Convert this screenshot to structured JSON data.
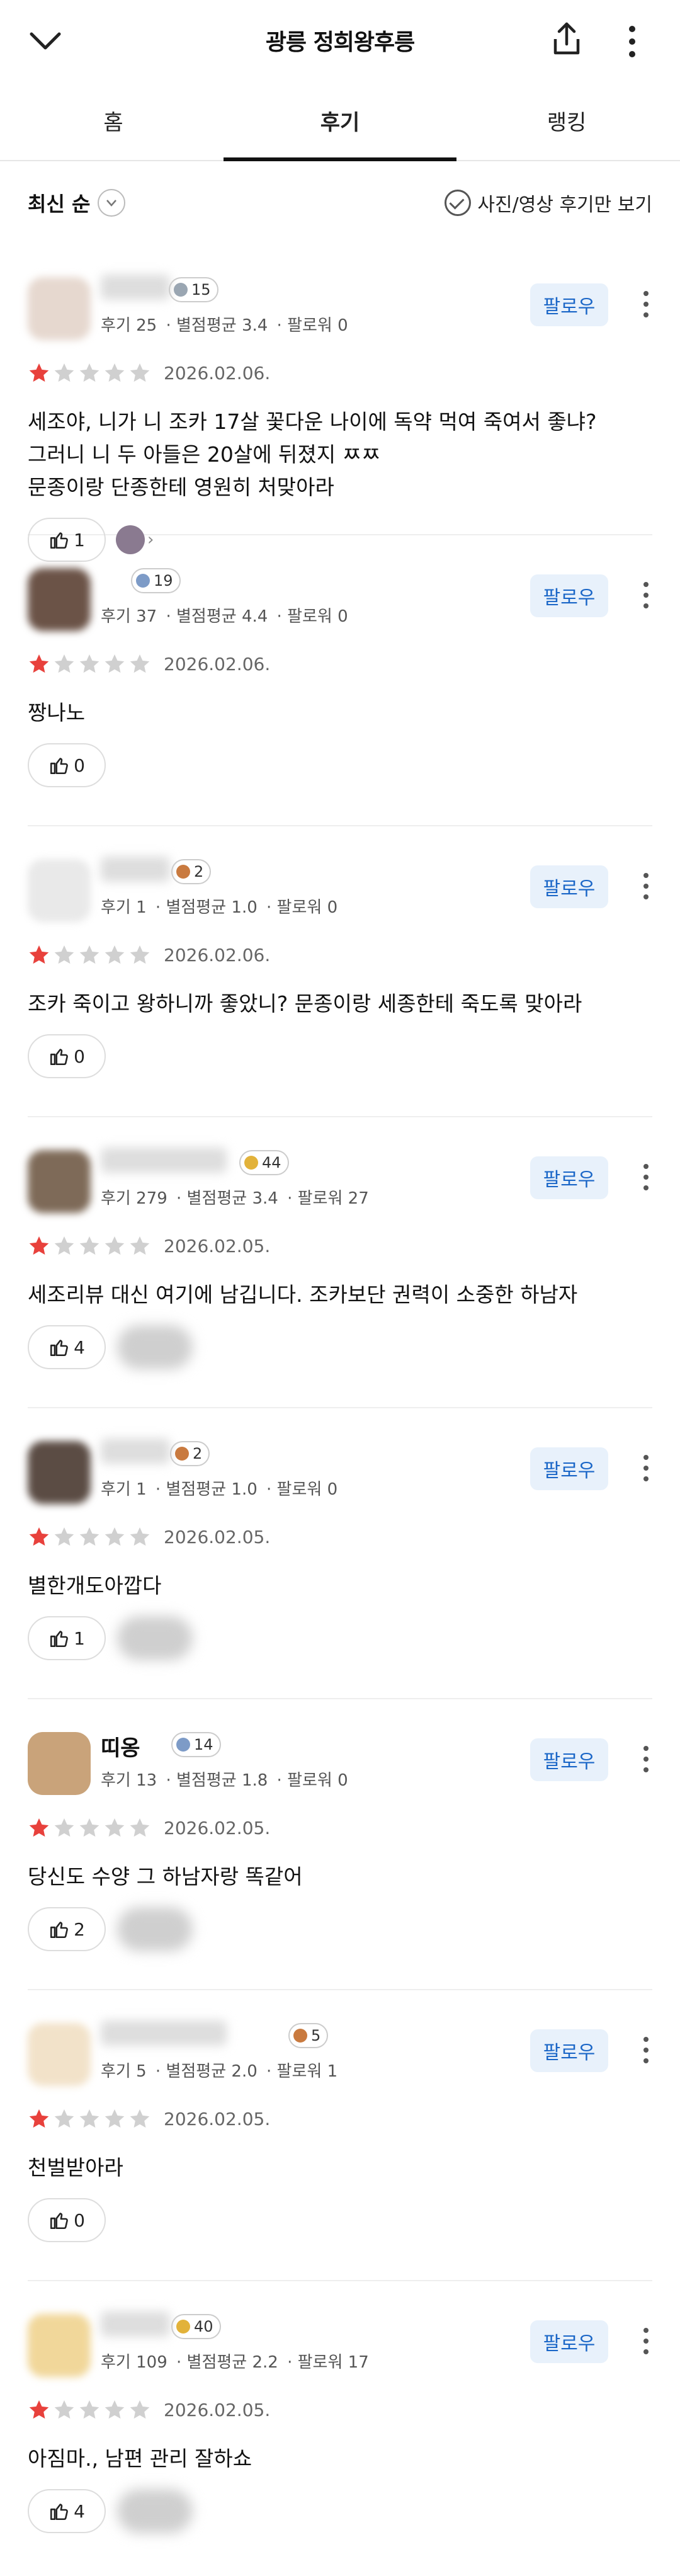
{
  "header": {
    "title": "광릉 정희왕후릉"
  },
  "tabs": [
    {
      "label": "홈"
    },
    {
      "label": "후기"
    },
    {
      "label": "랭킹"
    }
  ],
  "filter": {
    "sort_label": "최신 순",
    "photo_only_label": "사진/영상 후기만 보기"
  },
  "follow_label": "팔로우",
  "reviews": [
    {
      "name": "",
      "badge": "15",
      "reviews": "후기 25",
      "avg": "별점평균 3.4",
      "followers": "팔로워 0",
      "date": "2026.02.06.",
      "rating": 1,
      "lines": [
        "세조야, 니가 니 조카 17살 꽃다운 나이에 독약 먹여 죽여서 좋냐?",
        "그러니 니 두 아들은 20살에 뒤졌지 ㅉㅉ",
        "문종이랑 단종한테 영원히 처맞아라"
      ],
      "likes": "1"
    },
    {
      "name": "",
      "badge": "19",
      "reviews": "후기 37",
      "avg": "별점평균 4.4",
      "followers": "팔로워 0",
      "date": "2026.02.06.",
      "rating": 1,
      "lines": [
        "짱나노"
      ],
      "likes": "0"
    },
    {
      "name": "",
      "badge": "2",
      "reviews": "후기 1",
      "avg": "별점평균 1.0",
      "followers": "팔로워 0",
      "date": "2026.02.06.",
      "rating": 1,
      "lines": [
        "조카 죽이고 왕하니까 좋았니? 문종이랑 세종한테 죽도록 맞아라"
      ],
      "likes": "0"
    },
    {
      "name": "",
      "badge": "44",
      "reviews": "후기 279",
      "avg": "별점평균 3.4",
      "followers": "팔로워 27",
      "date": "2026.02.05.",
      "rating": 1,
      "lines": [
        "세조리뷰 대신 여기에 남깁니다. 조카보단 권력이 소중한 하남자"
      ],
      "likes": "4"
    },
    {
      "name": "",
      "badge": "2",
      "reviews": "후기 1",
      "avg": "별점평균 1.0",
      "followers": "팔로워 0",
      "date": "2026.02.05.",
      "rating": 1,
      "lines": [
        "별한개도아깝다"
      ],
      "likes": "1"
    },
    {
      "name": "띠옹",
      "badge": "14",
      "reviews": "후기 13",
      "avg": "별점평균 1.8",
      "followers": "팔로워 0",
      "date": "2026.02.05.",
      "rating": 1,
      "lines": [
        "당신도 수양 그 하남자랑 똑같어"
      ],
      "likes": "2"
    },
    {
      "name": "",
      "badge": "5",
      "reviews": "후기 5",
      "avg": "별점평균 2.0",
      "followers": "팔로워 1",
      "date": "2026.02.05.",
      "rating": 1,
      "lines": [
        "천벌받아라"
      ],
      "likes": "0"
    },
    {
      "name": "",
      "badge": "40",
      "reviews": "후기 109",
      "avg": "별점평균 2.2",
      "followers": "팔로워 17",
      "date": "2026.02.05.",
      "rating": 1,
      "lines": [
        "아짐마., 남편 관리 잘하쇼"
      ],
      "likes": "4"
    }
  ],
  "colors": {
    "star_on": "#e8413c",
    "star_off": "#d0d0d0",
    "follow_text": "#1a66c7",
    "follow_bg": "#e8f1fb"
  }
}
